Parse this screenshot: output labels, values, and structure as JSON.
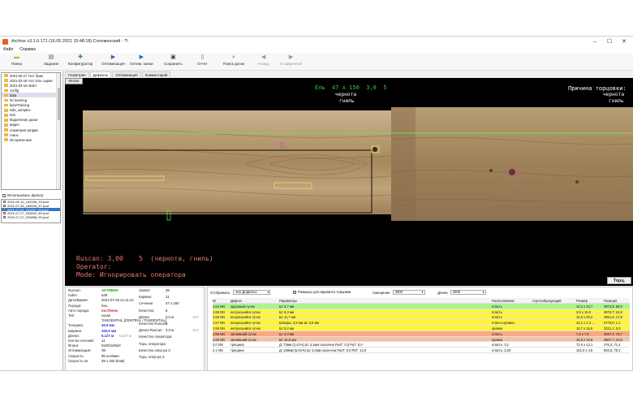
{
  "window": {
    "title": "Archive v3.1.0.171 (16.05.2021 15:48:18) Соломенский - ?\\"
  },
  "menu": [
    "Файл",
    "Справка"
  ],
  "toolbar": [
    {
      "label": "Папка",
      "icon": "folder-icon"
    },
    {
      "label": "Задание",
      "icon": "task-icon"
    },
    {
      "label": "Конфигуратор",
      "icon": "config-icon"
    },
    {
      "label": "Оптимизация",
      "icon": "optimize-icon"
    },
    {
      "label": "Оптим. папки",
      "icon": "optimize-folder-icon"
    },
    {
      "label": "Сохранить",
      "icon": "save-icon"
    },
    {
      "label": "Отчет",
      "icon": "report-icon"
    },
    {
      "label": "Поиск доски",
      "icon": "search-icon"
    },
    {
      "label": "Назад",
      "icon": "back-icon"
    },
    {
      "label": "К найденной",
      "icon": "forward-icon"
    }
  ],
  "tabs": [
    "Геометрия",
    "Дефекты",
    "Оптимизация",
    "Комментарий"
  ],
  "tree": [
    "2021-02-17 тест брак",
    "2021-02-18 тест Ель сырая",
    "2021-03-19-JKEA",
    "config",
    "data",
    "for learning",
    "lazarTraining",
    "side_samples",
    "test",
    "Выделение доски",
    "видео",
    "геометрия заправ",
    "гниль",
    "Исторические"
  ],
  "filter_label": "Использовать фильтр",
  "files": [
    "2021-06-10_162538_39.pcof",
    "2021-07-26_185828_57.pcof",
    "2021-07-26_211112_00.pcof",
    "2021-07-27_033842_89.pcof",
    "2021-07-27_033858_99.pcof"
  ],
  "board_button": "Мелки",
  "header": {
    "species": "Ель",
    "dims": "47 х 150",
    "grade1": "3,0",
    "grade2": "5",
    "defect1": "чернота",
    "defect2": "гниль",
    "reason_title": "Причина торцовки:",
    "reason1": "чернота",
    "reason2": "гниль"
  },
  "bottom": {
    "ruscan": "Ruscan: 3,00    5  (чернота, гниль)",
    "operator": "Operator:",
    "mode": "Mode: Игнорировать оператора"
  },
  "tortz_button": "Торц.",
  "info_left": [
    {
      "k": "Ruscan:",
      "v": "АКТИВЕН",
      "cls": "grn"
    },
    {
      "k": "Index:",
      "v": "529",
      "cls": ""
    },
    {
      "k": "Дата/Время:",
      "v": "2021-07-26 21:11:12",
      "cls": ""
    },
    {
      "k": "Порода:",
      "v": "Ель",
      "cls": ""
    },
    {
      "k": "Авто порода:",
      "v": "нн./Ленок",
      "cls": "red"
    },
    {
      "k": "Тип:",
      "v": "сухая",
      "cls": ""
    },
    {
      "k": "",
      "v": "TANGENTIAL [CENTRAL / TANGENTIAL]",
      "cls": ""
    },
    {
      "k": "Толщина:",
      "v": "46,9 мм",
      "cls": "blu"
    },
    {
      "k": "Ширина:",
      "v": "150,9 мм",
      "cls": "blu"
    },
    {
      "k": "Длина:",
      "v": "6,127 м",
      "cls": "blu"
    },
    {
      "k": "Кол-во сечений:",
      "v": "11",
      "cls": ""
    },
    {
      "k": "Флаги:",
      "v": "0x00210643",
      "cls": ""
    },
    {
      "k": "Оптимизация:",
      "v": "Ok",
      "cls": ""
    },
    {
      "k": "Скорость:",
      "v": "95 ноч/мин",
      "cls": ""
    },
    {
      "k": "Скорость кн:",
      "v": "39 х 150 (Ком)",
      "cls": ""
    }
  ],
  "length_extra": "6,127 м",
  "info_right": [
    {
      "k": "Захват:",
      "v": "38",
      "cls": ""
    },
    {
      "k": "Карман:",
      "v": "11",
      "cls": ""
    },
    {
      "k": "Сечение:",
      "v": "47 х 150",
      "cls": ""
    },
    {
      "k": "Качество:",
      "v": "5",
      "cls": "red"
    },
    {
      "k": "Длина:",
      "v": "3,0 м",
      "cls": ""
    },
    {
      "k": "Качество Ruscan:",
      "v": "5",
      "cls": ""
    },
    {
      "k": "Длина Ruscan:",
      "v": "3,0 м",
      "cls": ""
    },
    {
      "k": "Качество оператора:",
      "v": "",
      "cls": ""
    },
    {
      "k": "Торц. оператора:",
      "v": "",
      "cls": ""
    },
    {
      "k": "Качество опер-ра 2:",
      "v": "",
      "cls": ""
    },
    {
      "k": "Торц. опер-ра 2:",
      "v": "",
      "cls": ""
    }
  ],
  "length_ref": "~3.0",
  "length_ref2": "~3.0",
  "controls": {
    "display_label": "Отображать:",
    "display_value": "все Дефекты",
    "checkbox_label": "Размеры для варианта торцовки",
    "shift_label": "Смещение",
    "shift_value": "3000",
    "length_label": "Длина",
    "length_value": "3000"
  },
  "grid_head": [
    "ID",
    "Дефект",
    "Параметры",
    "Расположение",
    "Сортообразующий",
    "Размер",
    "Позиция"
  ],
  "grid_rows": [
    {
      "cls": "g",
      "c": [
        "1.54 NN",
        "здоровый сучок",
        "Ш: 6,7 мм",
        "пласть",
        "",
        "10,2 x 34,7",
        "4973,5; 58,0"
      ]
    },
    {
      "cls": "y",
      "c": [
        "1.55 NN",
        "несросшийся сучок",
        "Ш: 9,3 мм",
        "пласть",
        "",
        "3,9 x 18,0",
        "4876,7; 24,8"
      ]
    },
    {
      "cls": "y",
      "c": [
        "1.56 NN",
        "несросшийся сучок",
        "Ш: 11,7 мм",
        "пласть",
        "",
        "13,2 x 30,2",
        "4851,6; 17,9"
      ]
    },
    {
      "cls": "y",
      "c": [
        "1.57 NN",
        "несросшийся сучок",
        "Шлифы: 3,9 мм   Ш: 8,9 мм",
        "пласть-кромка",
        "",
        "10,1 x 2,3 ...",
        "5778,0; 1,1"
      ]
    },
    {
      "cls": "y",
      "c": [
        "1.58 NN",
        "несросшийся сучок",
        "Ш: 8,2 мм",
        "кромка",
        "",
        "10,7 x 16,9",
        "3321,1; 0,5"
      ]
    },
    {
      "cls": "o",
      "c": [
        "1.59 NN",
        "загнивший сучок",
        "Ш: 4,3 мм",
        "пласть",
        "",
        "7,9 x 7,0",
        "3297,4; 73,7"
      ]
    },
    {
      "cls": "o2",
      "c": [
        "1.60 NN",
        "загнивший сучок",
        "Ш: 16,5 мм",
        "кромка",
        "",
        "16,8 x 16,8",
        "3807,7; 21,6"
      ]
    },
    {
      "cls": "",
      "c": [
        "2.0 NN",
        "трещина",
        "Д: 73мм  (2,41%)   Ш: 3,1мм  скалочна    РазТ: 0,0   РаТ: 0,0",
        "пласть: 3,2",
        "",
        "72,6 x 13,1",
        "376,2; 71,4"
      ]
    },
    {
      "cls": "",
      "c": [
        "2.1 NN",
        "трещина",
        "Д: 159мм  (5,91%)   Ш: 4,2мм  скалочна    РазТ: 0,0   РаТ: 12,8",
        "пласть: 3,20",
        "",
        "152,0 x 4,9",
        "593,5; 78,2"
      ]
    }
  ]
}
